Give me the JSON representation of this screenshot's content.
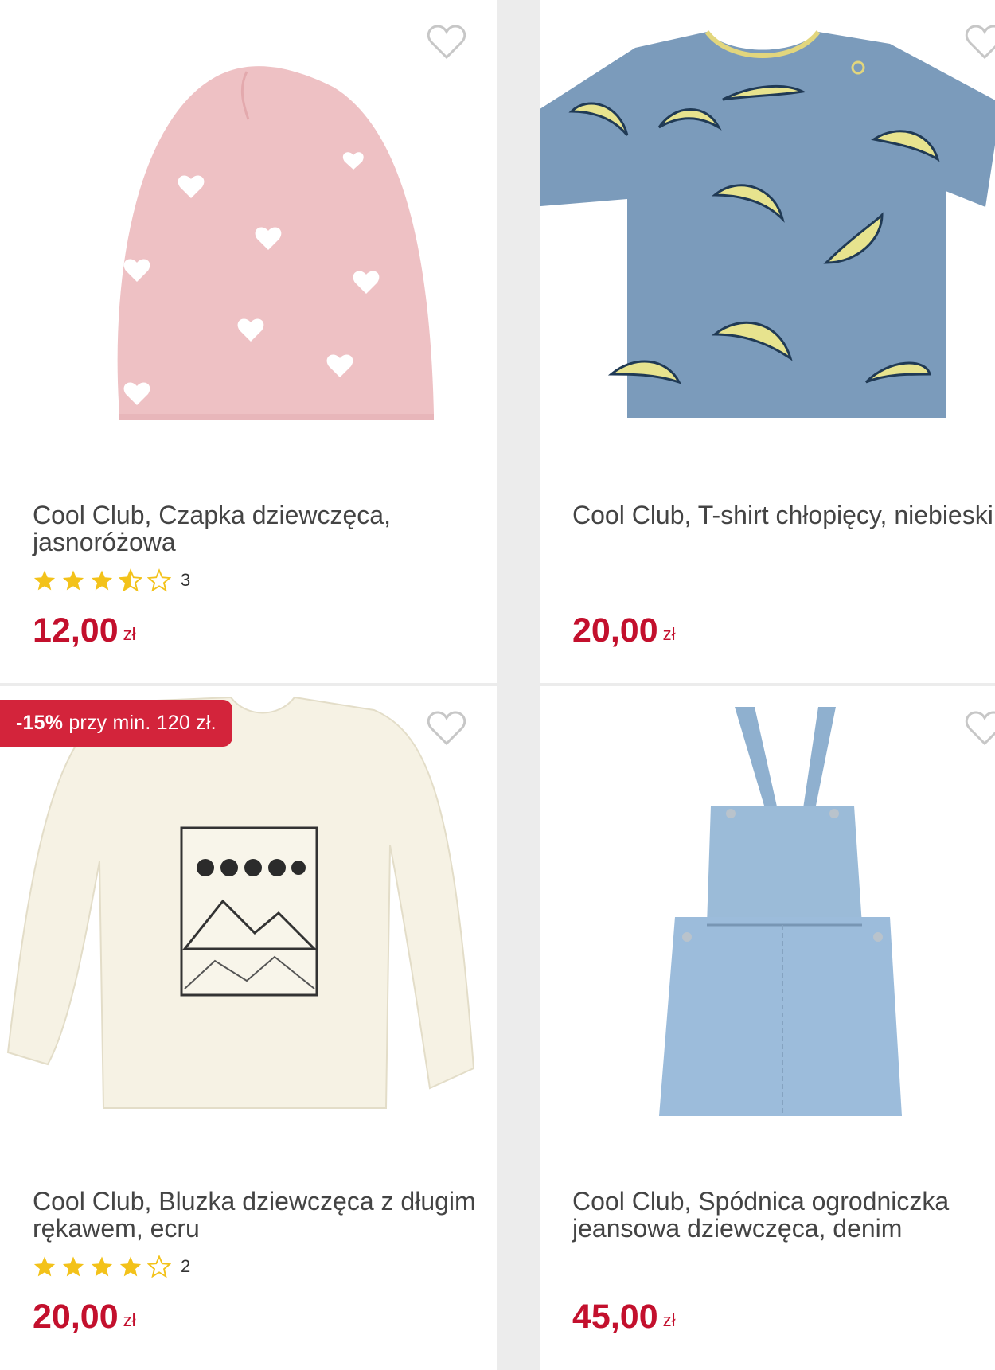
{
  "products": [
    {
      "image_alt": "pink knit hat with white hearts",
      "name": "Cool Club, Czapka dziewczęca, jasnoróżowa",
      "rating_count": "3",
      "rating": 3.5,
      "price": "12,00",
      "currency": "zł",
      "badge": null
    },
    {
      "image_alt": "blue t-shirt with bananas print",
      "name": "Cool Club, T-shirt chłopięcy, niebieski",
      "rating_count": null,
      "price": "20,00",
      "currency": "zł",
      "badge": null
    },
    {
      "image_alt": "ecru long-sleeve top with mountain print",
      "name": "Cool Club, Bluzka dziewczęca z długim rękawem, ecru",
      "rating_count": "2",
      "rating": 4,
      "price": "20,00",
      "currency": "zł",
      "badge": {
        "strong": "-15%",
        "text": " przy min. 120 zł."
      }
    },
    {
      "image_alt": "denim pinafore dress",
      "name": "Cool Club, Spódnica ogrodniczka jeansowa dziewczęca, denim",
      "rating_count": null,
      "price": "45,00",
      "currency": "zł",
      "badge": null
    }
  ],
  "colors": {
    "price": "#c3102d",
    "badge": "#d3243b",
    "star": "#f3c21a",
    "heart_outline": "#c7c7c7"
  },
  "icons": {
    "favorite": "heart-outline-icon",
    "star_full": "star-full-icon",
    "star_half": "star-half-icon",
    "star_empty": "star-empty-icon"
  }
}
